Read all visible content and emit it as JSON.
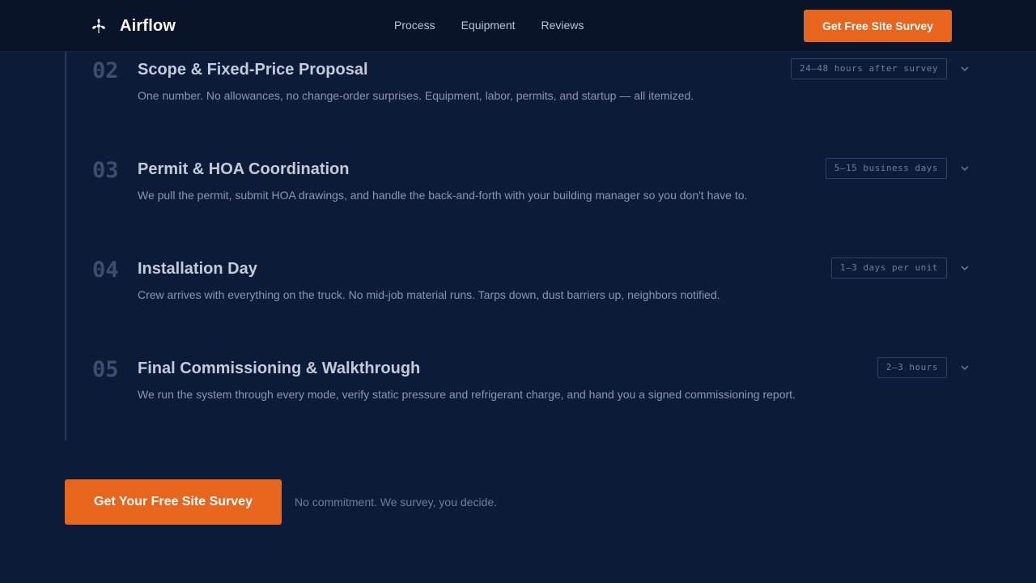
{
  "header": {
    "brand_name": "Airflow",
    "brand_icon": "fan-icon",
    "nav": [
      "Process",
      "Equipment",
      "Reviews"
    ],
    "cta_label": "Get Free Site Survey"
  },
  "steps": [
    {
      "number": "02",
      "title": "Scope & Fixed-Price Proposal",
      "description": "One number. No allowances, no change-order surprises. Equipment, labor, permits, and startup — all itemized.",
      "badge": "24–48 hours after survey"
    },
    {
      "number": "03",
      "title": "Permit & HOA Coordination",
      "description": "We pull the permit, submit HOA drawings, and handle the back-and-forth with your building manager so you don't have to.",
      "badge": "5–15 business days"
    },
    {
      "number": "04",
      "title": "Installation Day",
      "description": "Crew arrives with everything on the truck. No mid-job material runs. Tarps down, dust barriers up, neighbors notified.",
      "badge": "1–3 days per unit"
    },
    {
      "number": "05",
      "title": "Final Commissioning & Walkthrough",
      "description": "We run the system through every mode, verify static pressure and refrigerant charge, and hand you a signed commissioning report.",
      "badge": "2–3 hours"
    }
  ],
  "footer_cta": {
    "button_label": "Get Your Free Site Survey",
    "note": "No commitment. We survey, you decide."
  },
  "colors": {
    "background": "#0c1b38",
    "header": "#0a1428",
    "accent": "#e8651d"
  }
}
